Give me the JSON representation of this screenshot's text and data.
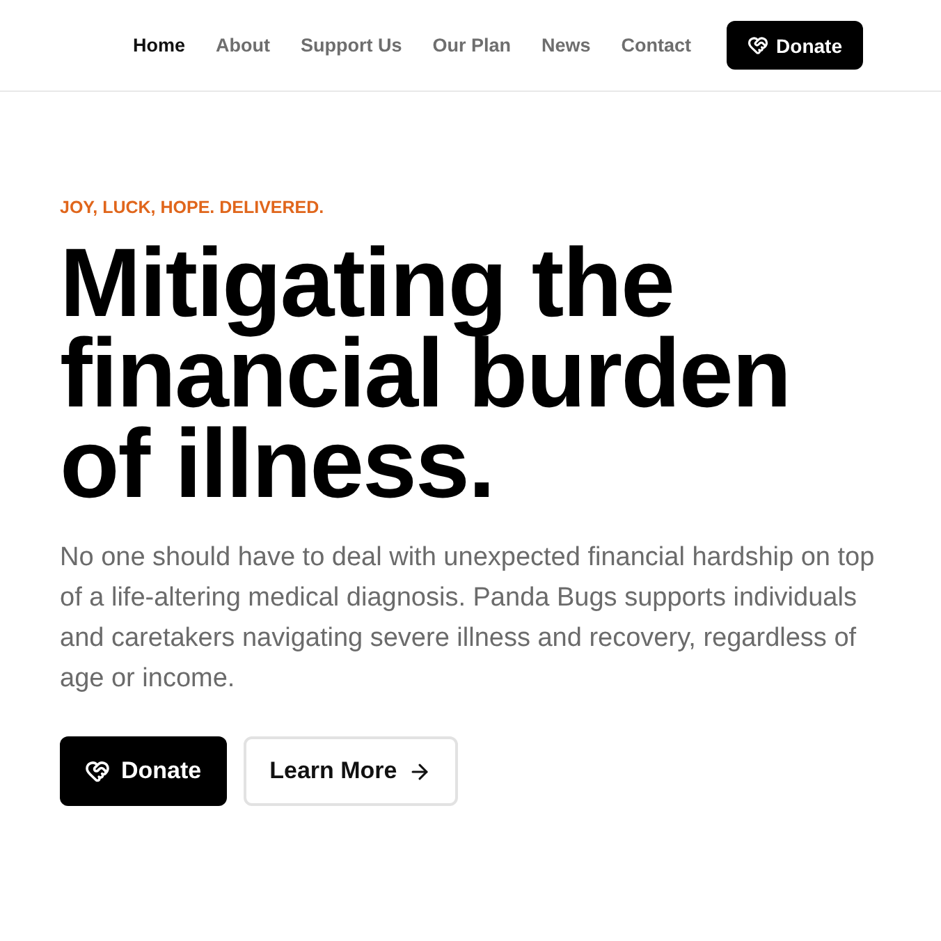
{
  "nav": {
    "links": [
      {
        "label": "Home",
        "selected": true
      },
      {
        "label": "About",
        "selected": false
      },
      {
        "label": "Support Us",
        "selected": false
      },
      {
        "label": "Our Plan",
        "selected": false
      },
      {
        "label": "News",
        "selected": false
      },
      {
        "label": "Contact",
        "selected": false
      }
    ],
    "donate_button": {
      "label": "Donate"
    }
  },
  "hero": {
    "eyebrow": "JOY, LUCK, HOPE. DELIVERED.",
    "headline": "Mitigating the financial burden of illness.",
    "description": "No one should have to deal with unexpected financial hardship on top of a life-altering medical diagnosis. Panda Bugs supports individuals and caretakers navigating severe illness and recovery, regardless of age or income.",
    "buttons": [
      {
        "label": "Donate",
        "kind": "primary"
      },
      {
        "label": "Learn More",
        "kind": "secondary"
      }
    ]
  }
}
